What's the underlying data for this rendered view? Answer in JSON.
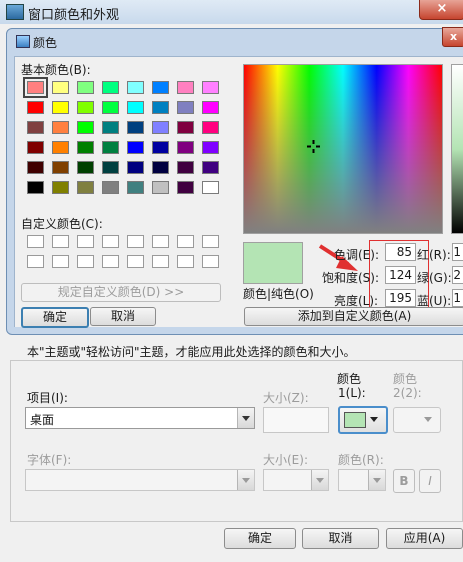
{
  "outer": {
    "title": "窗口颜色和外观",
    "close": "×"
  },
  "dialog": {
    "title": "颜色",
    "close": "x",
    "basic_label": "基本颜色(B):",
    "custom_label": "自定义颜色(C):",
    "define_button": "规定自定义颜色(D) >>",
    "ok": "确定",
    "cancel": "取消",
    "solid_label": "颜色|纯色(O)",
    "add_button": "添加到自定义颜色(A)",
    "hue_label": "色调(E):",
    "sat_label": "饱和度(S):",
    "lum_label": "亮度(L):",
    "red_label": "红(R):",
    "green_label": "绿(G):",
    "blue_label": "蓝(U):",
    "hue": "85",
    "sat": "124",
    "lum": "195",
    "red_partial": "1",
    "green_partial": "2",
    "blue_partial": "1",
    "basic_colors": [
      "#ff8080",
      "#ffff80",
      "#80ff80",
      "#00ff80",
      "#80ffff",
      "#0080ff",
      "#ff80c0",
      "#ff80ff",
      "#ff0000",
      "#ffff00",
      "#80ff00",
      "#00ff40",
      "#00ffff",
      "#0080c0",
      "#8080c0",
      "#ff00ff",
      "#804040",
      "#ff8040",
      "#00ff00",
      "#008080",
      "#004080",
      "#8080ff",
      "#800040",
      "#ff0080",
      "#800000",
      "#ff8000",
      "#008000",
      "#008040",
      "#0000ff",
      "#0000a0",
      "#800080",
      "#8000ff",
      "#400000",
      "#804000",
      "#004000",
      "#004040",
      "#000080",
      "#000040",
      "#400040",
      "#400080",
      "#000000",
      "#808000",
      "#808040",
      "#808080",
      "#408080",
      "#c0c0c0",
      "#400040",
      "#ffffff"
    ],
    "selected_color": "#b4e4b4"
  },
  "appearance": {
    "desc": "本\"主题或\"轻松访问\"主题，才能应用此处选择的颜色和大小。",
    "item_label": "项目(I):",
    "item_value": "桌面",
    "size_label": "大小(Z):",
    "color1_top": "颜色",
    "color1_bot": "1(L):",
    "color2_top": "颜色",
    "color2_bot": "2(2):",
    "font_label": "字体(F):",
    "size2_label": "大小(E):",
    "color_label": "颜色(R):",
    "bold": "B",
    "italic": "I",
    "swatch_color": "#b4e4b4"
  },
  "footer": {
    "ok": "确定",
    "cancel": "取消",
    "apply": "应用(A)"
  }
}
